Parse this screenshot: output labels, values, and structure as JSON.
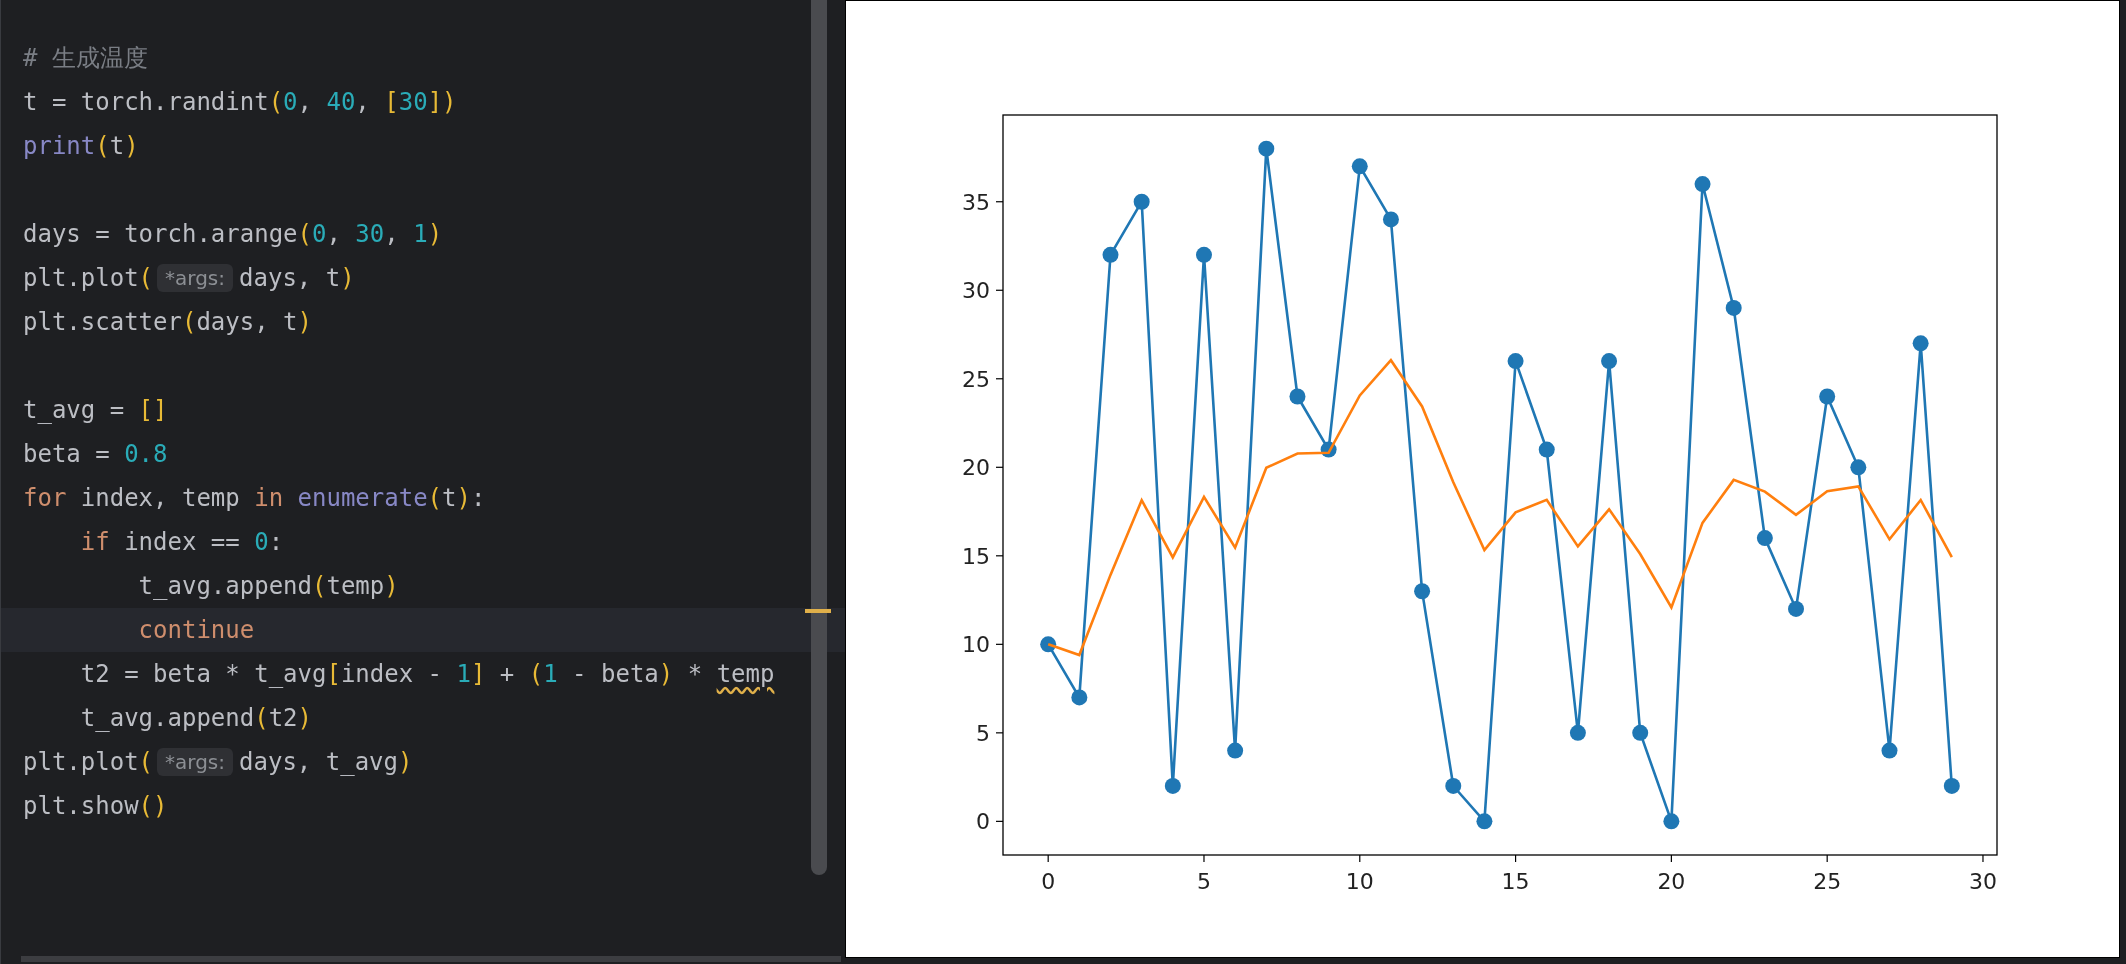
{
  "editor": {
    "lines": [
      {
        "current": false,
        "tokens": [
          {
            "text": "# 生成温度",
            "kind": "comment"
          }
        ]
      },
      {
        "current": false,
        "tokens": [
          {
            "text": "t = torch.randint",
            "kind": "plain"
          },
          {
            "text": "(",
            "kind": "paren"
          },
          {
            "text": "0",
            "kind": "number"
          },
          {
            "text": ", ",
            "kind": "plain"
          },
          {
            "text": "40",
            "kind": "number"
          },
          {
            "text": ", ",
            "kind": "plain"
          },
          {
            "text": "[",
            "kind": "paren"
          },
          {
            "text": "30",
            "kind": "number"
          },
          {
            "text": "])",
            "kind": "paren"
          }
        ]
      },
      {
        "current": false,
        "tokens": [
          {
            "text": "print",
            "kind": "builtin"
          },
          {
            "text": "(",
            "kind": "paren"
          },
          {
            "text": "t",
            "kind": "plain"
          },
          {
            "text": ")",
            "kind": "paren"
          }
        ]
      },
      {
        "current": false
      },
      {
        "current": false,
        "tokens": [
          {
            "text": "days = torch.arange",
            "kind": "plain"
          },
          {
            "text": "(",
            "kind": "paren"
          },
          {
            "text": "0",
            "kind": "number"
          },
          {
            "text": ", ",
            "kind": "plain"
          },
          {
            "text": "30",
            "kind": "number"
          },
          {
            "text": ", ",
            "kind": "plain"
          },
          {
            "text": "1",
            "kind": "number"
          },
          {
            "text": ")",
            "kind": "paren"
          }
        ]
      },
      {
        "current": false,
        "tokens": [
          {
            "text": "plt.plot",
            "kind": "plain"
          },
          {
            "text": "(",
            "kind": "paren"
          },
          {
            "text": "*args:",
            "kind": "hint"
          },
          {
            "text": "days, t",
            "kind": "plain"
          },
          {
            "text": ")",
            "kind": "paren"
          }
        ]
      },
      {
        "current": false,
        "tokens": [
          {
            "text": "plt.scatter",
            "kind": "plain"
          },
          {
            "text": "(",
            "kind": "paren"
          },
          {
            "text": "days, t",
            "kind": "plain"
          },
          {
            "text": ")",
            "kind": "paren"
          }
        ]
      },
      {
        "current": false
      },
      {
        "current": false,
        "tokens": [
          {
            "text": "t_avg = ",
            "kind": "plain"
          },
          {
            "text": "[]",
            "kind": "paren"
          }
        ]
      },
      {
        "current": false,
        "tokens": [
          {
            "text": "beta = ",
            "kind": "plain"
          },
          {
            "text": "0.8",
            "kind": "number"
          }
        ]
      },
      {
        "current": false,
        "tokens": [
          {
            "text": "for",
            "kind": "keyword"
          },
          {
            "text": " index, temp ",
            "kind": "plain"
          },
          {
            "text": "in",
            "kind": "keyword"
          },
          {
            "text": " enumerate",
            "kind": "builtin"
          },
          {
            "text": "(",
            "kind": "paren"
          },
          {
            "text": "t",
            "kind": "plain"
          },
          {
            "text": ")",
            "kind": "paren"
          },
          {
            "text": ":",
            "kind": "plain"
          }
        ]
      },
      {
        "current": false,
        "tokens": [
          {
            "text": "    if",
            "kind": "keyword"
          },
          {
            "text": " index == ",
            "kind": "plain"
          },
          {
            "text": "0",
            "kind": "number"
          },
          {
            "text": ":",
            "kind": "plain"
          }
        ]
      },
      {
        "current": false,
        "tokens": [
          {
            "text": "        t_avg.append",
            "kind": "plain"
          },
          {
            "text": "(",
            "kind": "paren"
          },
          {
            "text": "temp",
            "kind": "plain"
          },
          {
            "text": ")",
            "kind": "paren"
          }
        ]
      },
      {
        "current": true,
        "tokens": [
          {
            "text": "        continue",
            "kind": "keyword"
          }
        ]
      },
      {
        "current": false,
        "tokens": [
          {
            "text": "    t2 = beta * t_avg",
            "kind": "plain"
          },
          {
            "text": "[",
            "kind": "paren"
          },
          {
            "text": "index - ",
            "kind": "plain"
          },
          {
            "text": "1",
            "kind": "number"
          },
          {
            "text": "]",
            "kind": "paren"
          },
          {
            "text": " + ",
            "kind": "plain"
          },
          {
            "text": "(",
            "kind": "paren"
          },
          {
            "text": "1",
            "kind": "number"
          },
          {
            "text": " - beta",
            "kind": "plain"
          },
          {
            "text": ")",
            "kind": "paren"
          },
          {
            "text": " * ",
            "kind": "plain"
          },
          {
            "text": "temp",
            "kind": "warning"
          }
        ]
      },
      {
        "current": false,
        "tokens": [
          {
            "text": "    t_avg.append",
            "kind": "plain"
          },
          {
            "text": "(",
            "kind": "paren"
          },
          {
            "text": "t2",
            "kind": "plain"
          },
          {
            "text": ")",
            "kind": "paren"
          }
        ]
      },
      {
        "current": false,
        "tokens": [
          {
            "text": "plt.plot",
            "kind": "plain"
          },
          {
            "text": "(",
            "kind": "paren"
          },
          {
            "text": "*args:",
            "kind": "hint"
          },
          {
            "text": "days, t_avg",
            "kind": "plain"
          },
          {
            "text": ")",
            "kind": "paren"
          }
        ]
      },
      {
        "current": false,
        "tokens": [
          {
            "text": "plt.show",
            "kind": "plain"
          },
          {
            "text": "()",
            "kind": "paren"
          }
        ]
      }
    ]
  },
  "figure": {
    "chart_data": {
      "type": "line",
      "x": [
        0,
        1,
        2,
        3,
        4,
        5,
        6,
        7,
        8,
        9,
        10,
        11,
        12,
        13,
        14,
        15,
        16,
        17,
        18,
        19,
        20,
        21,
        22,
        23,
        24,
        25,
        26,
        27,
        28,
        29
      ],
      "xlim": [
        -1.45,
        30.45
      ],
      "ylim": [
        -1.9,
        39.9
      ],
      "xticks": [
        0,
        5,
        10,
        15,
        20,
        25,
        30
      ],
      "yticks": [
        0,
        5,
        10,
        15,
        20,
        25,
        30,
        35
      ],
      "series": [
        {
          "color": "#1f77b4",
          "marker": true,
          "values": [
            10,
            7,
            32,
            35,
            2,
            32,
            4,
            38,
            24,
            21,
            37,
            34,
            13,
            2,
            0,
            26,
            21,
            5,
            26,
            5,
            0,
            36,
            29,
            16,
            12,
            24,
            20,
            4,
            27,
            2
          ]
        },
        {
          "color": "#ff7f0e",
          "marker": false,
          "values": [
            10,
            9.4,
            13.92,
            18.14,
            14.91,
            18.33,
            15.46,
            19.97,
            20.78,
            20.82,
            24.06,
            26.05,
            23.44,
            19.15,
            15.32,
            17.46,
            18.16,
            15.53,
            17.63,
            15.1,
            12.08,
            16.86,
            19.29,
            18.63,
            17.31,
            18.65,
            18.92,
            15.93,
            18.15,
            14.92
          ]
        }
      ]
    }
  }
}
